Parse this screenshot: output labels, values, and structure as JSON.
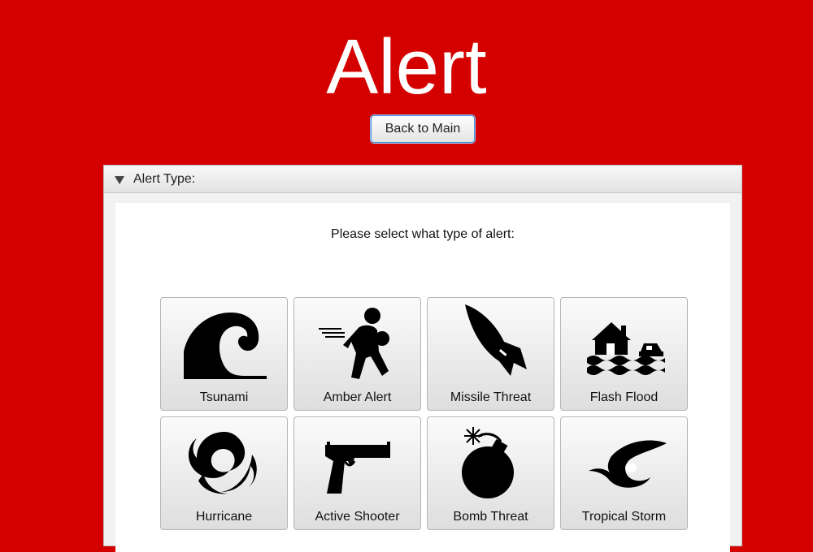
{
  "header": {
    "title": "Alert",
    "back_button_label": "Back to Main"
  },
  "alert_type_pane": {
    "header_label": "Alert Type:",
    "expanded": true,
    "prompt": "Please select what type of alert:",
    "options": [
      {
        "label": "Tsunami",
        "icon": "tsunami-icon"
      },
      {
        "label": "Amber Alert",
        "icon": "amber-alert-icon"
      },
      {
        "label": "Missile Threat",
        "icon": "missile-icon"
      },
      {
        "label": "Flash Flood",
        "icon": "flash-flood-icon"
      },
      {
        "label": "Hurricane",
        "icon": "hurricane-icon"
      },
      {
        "label": "Active Shooter",
        "icon": "handgun-icon"
      },
      {
        "label": "Bomb Threat",
        "icon": "bomb-icon"
      },
      {
        "label": "Tropical Storm",
        "icon": "tropical-storm-icon"
      }
    ]
  },
  "colors": {
    "background": "#d40000",
    "title_text": "#ffffff",
    "icon_fill": "#000000"
  }
}
